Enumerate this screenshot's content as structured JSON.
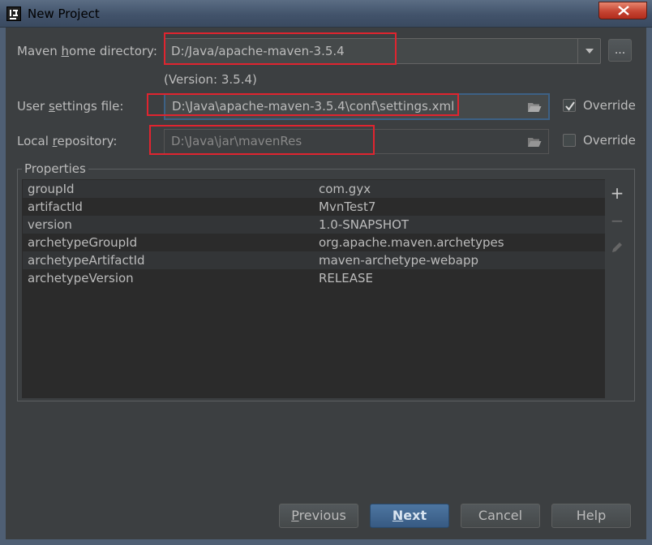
{
  "window": {
    "title": "New Project"
  },
  "maven_home": {
    "label_pre": "Maven ",
    "label_u": "h",
    "label_post": "ome directory:",
    "value": "D:/Java/apache-maven-3.5.4",
    "version": "(Version: 3.5.4)",
    "browse_label": "..."
  },
  "user_settings": {
    "label_pre": "User ",
    "label_u": "s",
    "label_post": "ettings file:",
    "value": "D:\\Java\\apache-maven-3.5.4\\conf\\settings.xml",
    "override_label": "Override",
    "override_checked": true
  },
  "local_repo": {
    "label_pre": "Local ",
    "label_u": "r",
    "label_post": "epository:",
    "value": "D:\\Java\\jar\\mavenRes",
    "override_label": "Override",
    "override_checked": false
  },
  "properties": {
    "title": "Properties",
    "rows": [
      {
        "key": "groupId",
        "value": "com.gyx"
      },
      {
        "key": "artifactId",
        "value": "MvnTest7"
      },
      {
        "key": "version",
        "value": "1.0-SNAPSHOT"
      },
      {
        "key": "archetypeGroupId",
        "value": "org.apache.maven.archetypes"
      },
      {
        "key": "archetypeArtifactId",
        "value": "maven-archetype-webapp"
      },
      {
        "key": "archetypeVersion",
        "value": "RELEASE"
      }
    ],
    "tools": {
      "add": "+",
      "remove": "−"
    }
  },
  "buttons": {
    "previous_u": "P",
    "previous_rest": "revious",
    "next_u": "N",
    "next_rest": "ext",
    "cancel": "Cancel",
    "help": "Help"
  },
  "colors": {
    "accent": "#3d6185",
    "highlight": "#e0242f",
    "primary_button": "#4d76a1"
  }
}
